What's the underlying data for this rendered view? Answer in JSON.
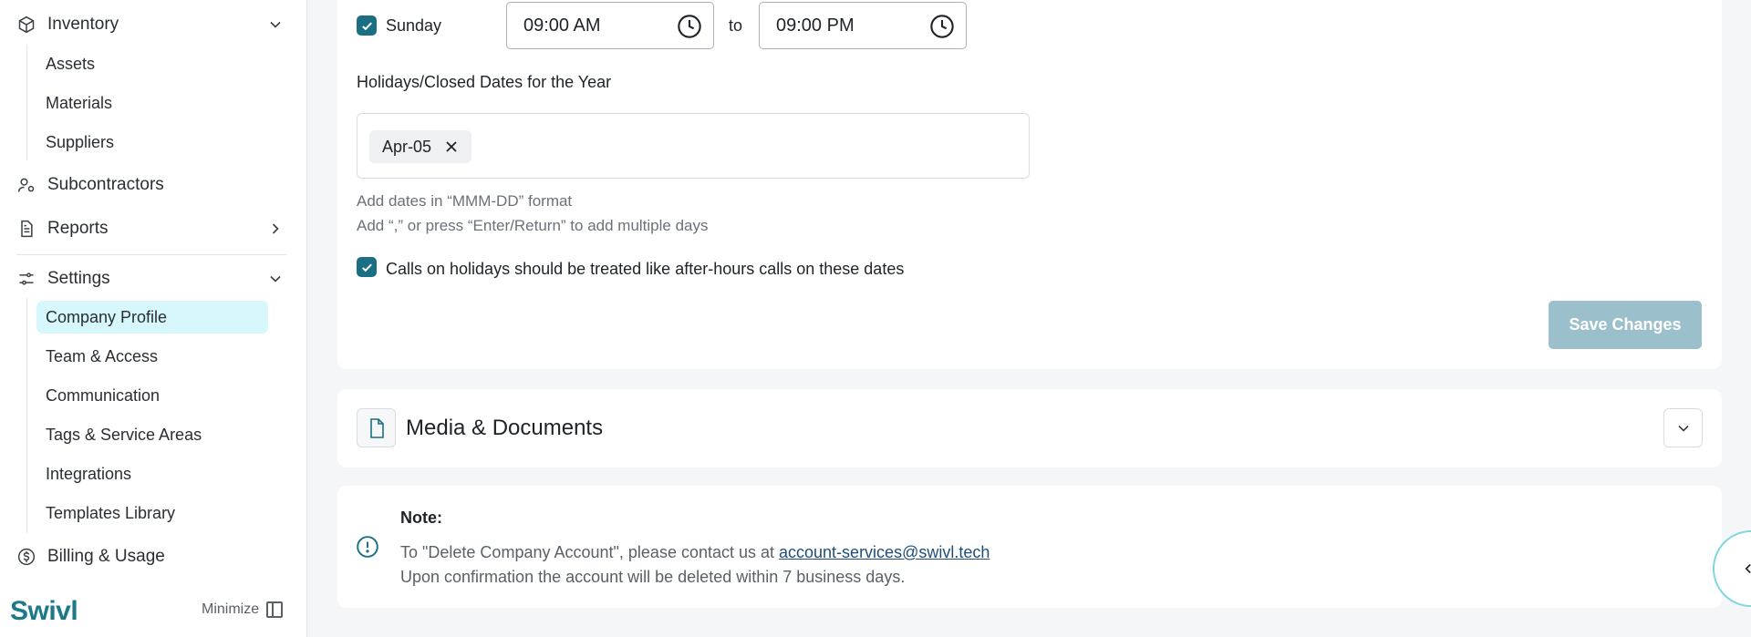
{
  "sidebar": {
    "inventory": {
      "label": "Inventory",
      "children": [
        "Assets",
        "Materials",
        "Suppliers"
      ]
    },
    "subcontractors": {
      "label": "Subcontractors"
    },
    "reports": {
      "label": "Reports"
    },
    "settings": {
      "label": "Settings",
      "children": [
        "Company Profile",
        "Team & Access",
        "Communication",
        "Tags & Service Areas",
        "Integrations",
        "Templates Library"
      ],
      "active": "Company Profile"
    },
    "billing": {
      "label": "Billing & Usage"
    },
    "brand": "Swivl",
    "minimize_label": "Minimize"
  },
  "hours": {
    "day_label": "Sunday",
    "day_checked": true,
    "start_time": "09:00 AM",
    "to_label": "to",
    "end_time": "09:00 PM"
  },
  "holidays": {
    "section_label": "Holidays/Closed Dates for the Year",
    "chips": [
      "Apr-05"
    ],
    "helper_line1": "Add dates in “MMM-DD” format",
    "helper_line2": "Add “,” or press “Enter/Return” to add multiple days",
    "after_hours_label": "Calls on holidays should be treated like after-hours calls on these dates",
    "after_hours_checked": true,
    "save_label": "Save Changes"
  },
  "media": {
    "title": "Media & Documents"
  },
  "note": {
    "title": "Note:",
    "line1_prefix": "To \"Delete Company Account\", please contact us at ",
    "email": "account-services@swivl.tech",
    "line2": "Upon confirmation the account will be deleted within 7 business days."
  },
  "colors": {
    "accent": "#1a6f82",
    "active_nav_bg": "#d6f7fb",
    "save_disabled": "#9cbfcc",
    "brand": "#1c7a86"
  }
}
